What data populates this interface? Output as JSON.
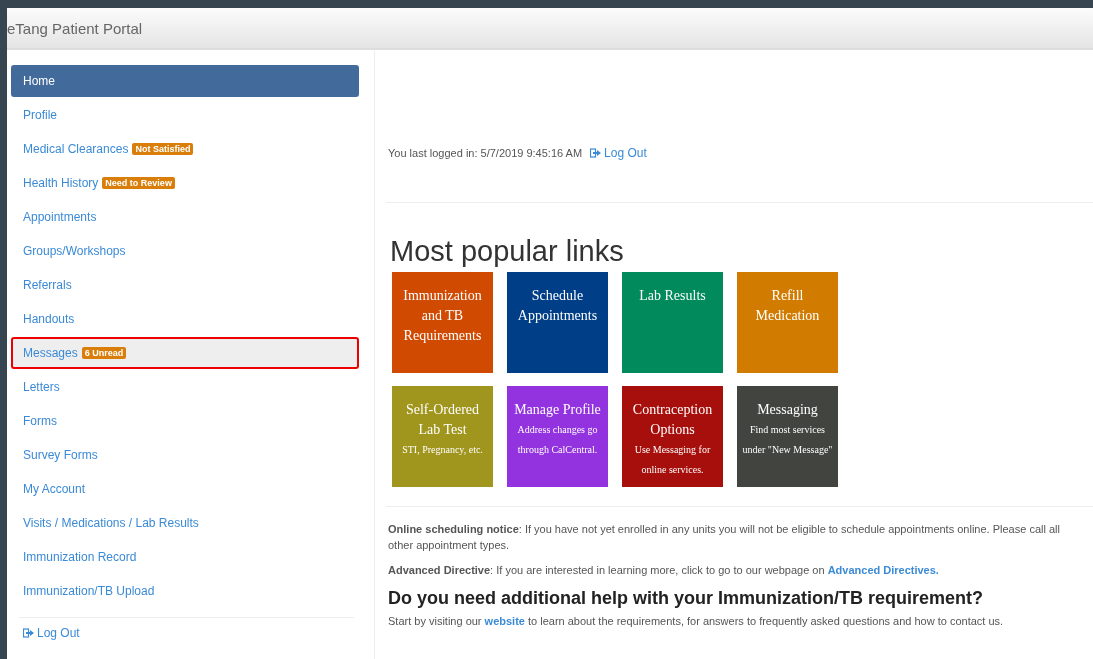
{
  "header": {
    "title": "eTang Patient Portal"
  },
  "sidebar": {
    "items": [
      {
        "label": "Home",
        "selected": true,
        "highlighted": false
      },
      {
        "label": "Profile",
        "selected": false,
        "highlighted": false
      },
      {
        "label": "Medical Clearances",
        "badge": "Not Satisfied",
        "selected": false,
        "highlighted": false
      },
      {
        "label": "Health History",
        "badge": "Need to Review",
        "selected": false,
        "highlighted": false
      },
      {
        "label": "Appointments",
        "selected": false,
        "highlighted": false
      },
      {
        "label": "Groups/Workshops",
        "selected": false,
        "highlighted": false
      },
      {
        "label": "Referrals",
        "selected": false,
        "highlighted": false
      },
      {
        "label": "Handouts",
        "selected": false,
        "highlighted": false
      },
      {
        "label": "Messages",
        "badge": "6 Unread",
        "selected": false,
        "highlighted": true
      },
      {
        "label": "Letters",
        "selected": false,
        "highlighted": false
      },
      {
        "label": "Forms",
        "selected": false,
        "highlighted": false
      },
      {
        "label": "Survey Forms",
        "selected": false,
        "highlighted": false
      },
      {
        "label": "My Account",
        "selected": false,
        "highlighted": false
      },
      {
        "label": "Visits / Medications / Lab Results",
        "selected": false,
        "highlighted": false
      },
      {
        "label": "Immunization Record",
        "selected": false,
        "highlighted": false
      },
      {
        "label": "Immunization/TB Upload",
        "selected": false,
        "highlighted": false
      }
    ],
    "logout": "Log Out"
  },
  "last_login": {
    "text": "You last logged in: 5/7/2019 9:45:16 AM",
    "logout": "Log Out"
  },
  "popular": {
    "heading": "Most popular links",
    "tiles": [
      {
        "title": "Immunization and TB Requirements",
        "color": "#d04a02"
      },
      {
        "title": "Schedule Appointments",
        "color": "#003f87"
      },
      {
        "title": "Lab Results",
        "color": "#018a5b"
      },
      {
        "title": "Refill Medication",
        "color": "#d17c00"
      },
      {
        "title": "Self-Ordered Lab Test",
        "subtitle": "STI, Pregnancy, etc.",
        "color": "#a0951d"
      },
      {
        "title": "Manage Profile",
        "subtitle": "Address changes go through CalCentral.",
        "color": "#9333e0"
      },
      {
        "title": "Contraception Options",
        "subtitle": "Use Messaging for online services.",
        "color": "#a60f0b"
      },
      {
        "title": "Messaging",
        "subtitle": "Find most services under \"New Message\"",
        "color": "#42453f"
      }
    ]
  },
  "notices": [
    {
      "text": "**Online scheduling notice**: If you have not yet enrolled in any units you will not be eligible to schedule appointments online. Please call all other appointment types."
    },
    {
      "text": "**Advanced Directive**: If you are interested in learning more, click to go to our webpage on ",
      "link": "Advanced Directives."
    }
  ],
  "help": {
    "heading": "Do you need additional help with your Immunization/TB requirement?",
    "before": "Start by visiting our ",
    "link": "website",
    "after": " to learn about the requirements, for answers to frequently asked questions and how to contact us."
  }
}
